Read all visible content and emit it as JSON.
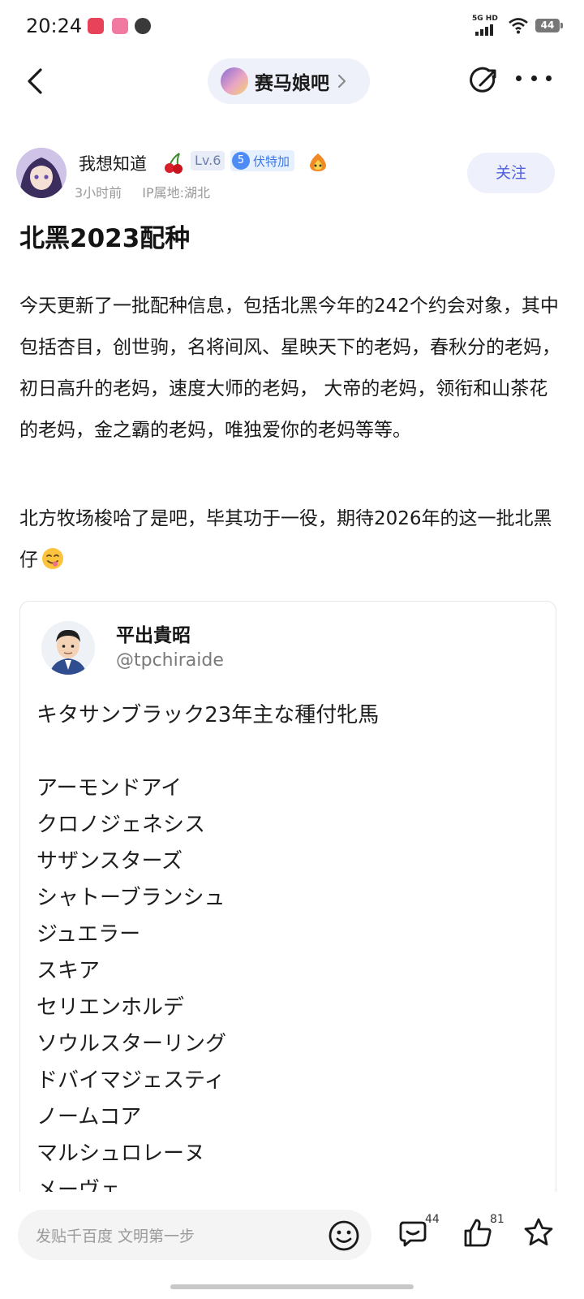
{
  "status_bar": {
    "time": "20:24",
    "network_label": "5G HD",
    "battery": "44"
  },
  "nav": {
    "forum_name": "赛马娘吧"
  },
  "author": {
    "name": "我想知道",
    "level": "Lv.6",
    "vip_level": "5",
    "vip_name": "伏特加",
    "time_ago": "3小时前",
    "ip_location": "IP属地:湖北",
    "follow_label": "关注"
  },
  "post": {
    "title": "北黑2023配种",
    "paragraph1": "今天更新了一批配种信息，包括北黑今年的242个约会对象，其中包括杏目，创世驹，名将间风、星映天下的老妈，春秋分的老妈，初日高升的老妈，速度大师的老妈， 大帝的老妈，领衔和山茶花的老妈，金之霸的老妈，唯独爱你的老妈等等。",
    "paragraph2": "北方牧场梭哈了是吧，毕其功于一役，期待2026年的这一批北黑仔"
  },
  "quoted_tweet": {
    "display_name": "平出貴昭",
    "handle": "@tpchiraide",
    "heading": "キタサンブラック23年主な種付牝馬",
    "mares": [
      "アーモンドアイ",
      "クロノジェネシス",
      "サザンスターズ",
      "シャトーブランシュ",
      "ジュエラー",
      "スキア",
      "セリエンホルデ",
      "ソウルスターリング",
      "ドバイマジェスティ",
      "ノームコア",
      "マルシュロレーヌ",
      "メーヴェ"
    ]
  },
  "bottom_bar": {
    "input_placeholder": "发贴千百度 文明第一步",
    "comment_count": "44",
    "like_count": "81"
  },
  "colors": {
    "accent": "#4e5ee0",
    "follow_bg": "#eef0fb",
    "vip_blue": "#4d8cf5",
    "meta_gray": "#9a9a9a"
  },
  "icons": [
    "back-arrow-icon",
    "chevron-right-icon",
    "edit-icon",
    "more-icon",
    "cherry-icon",
    "fire-badge-icon",
    "smile-emoji-icon",
    "comment-icon",
    "like-icon",
    "star-icon",
    "savoring-emoji-icon"
  ]
}
